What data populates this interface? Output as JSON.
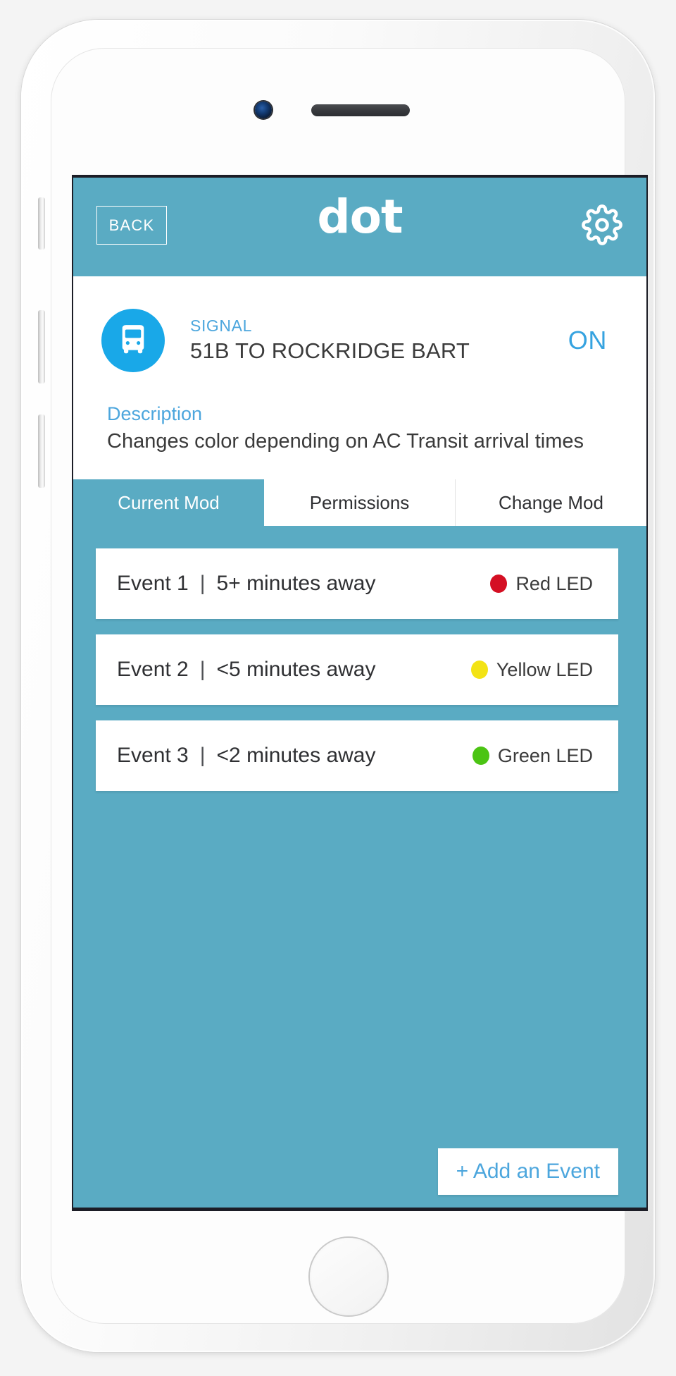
{
  "device": {
    "camera_icon": "front-camera",
    "speaker_icon": "earpiece-speaker",
    "home_button": "home-button",
    "silent_switch": "silent-switch",
    "volume_up": "volume-up-button",
    "volume_down": "volume-down-button",
    "power": "power-button"
  },
  "header": {
    "back_label": "BACK",
    "title": "dot",
    "settings_icon": "gear-icon",
    "background_color": "#5aabc3",
    "text_color": "#ffffff"
  },
  "signal_card": {
    "icon": "bus-icon",
    "icon_background": "#19a8e8",
    "label": "SIGNAL",
    "name": "51B TO ROCKRIDGE BART",
    "state": "ON",
    "state_color": "#36a3e0",
    "description_label": "Description",
    "description_text": "Changes color depending on AC Transit arrival times"
  },
  "tabs": [
    {
      "label": "Current Mod",
      "active": true
    },
    {
      "label": "Permissions",
      "active": false
    },
    {
      "label": "Change Mod",
      "active": false
    }
  ],
  "events": [
    {
      "number": "Event 1",
      "separator": "|",
      "condition": "5+ minutes away",
      "led_label": "Red LED",
      "led_color": "#d40f23"
    },
    {
      "number": "Event 2",
      "separator": "|",
      "condition": "<5 minutes away",
      "led_label": "Yellow LED",
      "led_color": "#f3e315"
    },
    {
      "number": "Event 3",
      "separator": "|",
      "condition": "<2 minutes away",
      "led_label": "Green LED",
      "led_color": "#4bc413"
    }
  ],
  "footer": {
    "add_event_label": "+ Add an Event",
    "add_event_color": "#4ca6dd"
  }
}
